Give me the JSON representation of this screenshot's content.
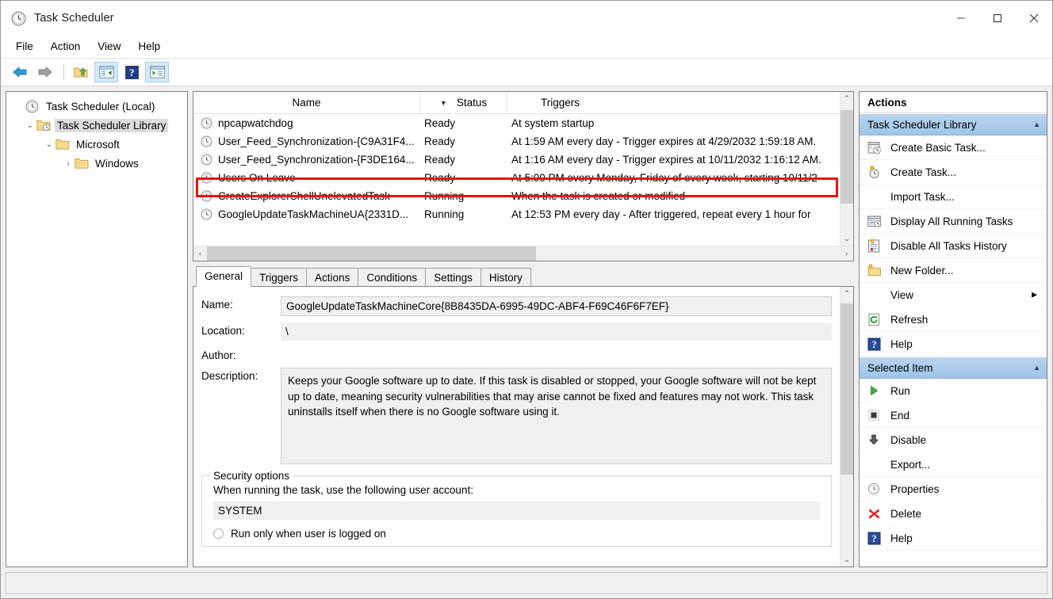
{
  "window": {
    "title": "Task Scheduler",
    "icon": "clock-icon",
    "minimize_label": "–",
    "maximize_label": "□",
    "close_label": "✕"
  },
  "menubar": {
    "items": [
      {
        "label": "File"
      },
      {
        "label": "Action"
      },
      {
        "label": "View"
      },
      {
        "label": "Help"
      }
    ]
  },
  "toolbar": {
    "buttons": [
      {
        "name": "back-arrow-icon",
        "label": ""
      },
      {
        "name": "forward-arrow-icon",
        "label": ""
      },
      {
        "name": "up-one-level-icon",
        "label": ""
      },
      {
        "name": "show-hide-console-tree-icon",
        "label": ""
      },
      {
        "name": "help-icon",
        "label": ""
      },
      {
        "name": "show-hide-action-pane-icon",
        "label": ""
      }
    ]
  },
  "tree": {
    "nodes": [
      {
        "label": "Task Scheduler (Local)",
        "icon": "clock-icon",
        "indent": 0,
        "chevron": "",
        "selected": false
      },
      {
        "label": "Task Scheduler Library",
        "icon": "library-folder-icon",
        "indent": 1,
        "chevron": "⌄",
        "selected": true
      },
      {
        "label": "Microsoft",
        "icon": "folder-icon",
        "indent": 2,
        "chevron": "⌄",
        "selected": false
      },
      {
        "label": "Windows",
        "icon": "folder-icon",
        "indent": 3,
        "chevron": "›",
        "selected": false
      }
    ]
  },
  "tasklist": {
    "columns": [
      {
        "label": "Name",
        "sorted": false
      },
      {
        "label": "Status",
        "sorted": true,
        "sort_arrow": "▼"
      },
      {
        "label": "Triggers",
        "sorted": false
      }
    ],
    "rows": [
      {
        "name": "npcapwatchdog",
        "status": "Ready",
        "trigger": "At system startup",
        "highlighted": false
      },
      {
        "name": "User_Feed_Synchronization-{C9A31F4...",
        "status": "Ready",
        "trigger": "At 1:59 AM every day - Trigger expires at 4/29/2032 1:59:18 AM.",
        "highlighted": false
      },
      {
        "name": "User_Feed_Synchronization-{F3DE164...",
        "status": "Ready",
        "trigger": "At 1:16 AM every day - Trigger expires at 10/11/2032 1:16:12 AM.",
        "highlighted": false
      },
      {
        "name": "Users On Leave",
        "status": "Ready",
        "trigger": "At 5:00 PM every Monday, Friday of every week, starting 10/11/2",
        "highlighted": true
      },
      {
        "name": "CreateExplorerShellUnelevatedTask",
        "status": "Running",
        "trigger": "When the task is created or modified",
        "highlighted": false
      },
      {
        "name": "GoogleUpdateTaskMachineUA{2331D...",
        "status": "Running",
        "trigger": "At 12:53 PM every day - After triggered, repeat every 1 hour for",
        "highlighted": false
      }
    ],
    "scroll_up_glyph": "⌃",
    "scroll_down_glyph": "⌄",
    "scroll_left_glyph": "‹",
    "scroll_right_glyph": "›"
  },
  "tabs": [
    {
      "label": "General",
      "active": true
    },
    {
      "label": "Triggers",
      "active": false
    },
    {
      "label": "Actions",
      "active": false
    },
    {
      "label": "Conditions",
      "active": false
    },
    {
      "label": "Settings",
      "active": false
    },
    {
      "label": "History",
      "active": false
    }
  ],
  "general": {
    "name_label": "Name:",
    "name_value": "GoogleUpdateTaskMachineCore{8B8435DA-6995-49DC-ABF4-F69C46F6F7EF}",
    "location_label": "Location:",
    "location_value": "\\",
    "author_label": "Author:",
    "author_value": "",
    "description_label": "Description:",
    "description_value": "Keeps your Google software up to date. If this task is disabled or stopped, your Google software will not be kept up to date, meaning security vulnerabilities that may arise cannot be fixed and features may not work. This task uninstalls itself when there is no Google software using it.",
    "security_group_title": "Security options",
    "security_prompt": "When running the task, use the following user account:",
    "account": "SYSTEM",
    "run_only_logged_on_label": "Run only when user is logged on"
  },
  "actions": {
    "title": "Actions",
    "sections": [
      {
        "title": "Task Scheduler Library",
        "collapse_glyph": "▲",
        "items": [
          {
            "label": "Create Basic Task...",
            "icon": "create-basic-task-icon"
          },
          {
            "label": "Create Task...",
            "icon": "create-task-icon"
          },
          {
            "label": "Import Task...",
            "icon": ""
          },
          {
            "label": "Display All Running Tasks",
            "icon": "display-running-tasks-icon"
          },
          {
            "label": "Disable All Tasks History",
            "icon": "disable-history-icon"
          },
          {
            "label": "New Folder...",
            "icon": "new-folder-icon"
          },
          {
            "label": "View",
            "icon": "",
            "submenu": true,
            "submenu_glyph": "▶"
          },
          {
            "label": "Refresh",
            "icon": "refresh-icon"
          },
          {
            "label": "Help",
            "icon": "help-icon"
          }
        ]
      },
      {
        "title": "Selected Item",
        "collapse_glyph": "▲",
        "items": [
          {
            "label": "Run",
            "icon": "run-play-icon"
          },
          {
            "label": "End",
            "icon": "end-stop-icon"
          },
          {
            "label": "Disable",
            "icon": "disable-down-arrow-icon"
          },
          {
            "label": "Export...",
            "icon": ""
          },
          {
            "label": "Properties",
            "icon": "clock-icon"
          },
          {
            "label": "Delete",
            "icon": "delete-x-icon"
          },
          {
            "label": "Help",
            "icon": "help-icon"
          }
        ]
      }
    ]
  },
  "annotation": {
    "highlight_color": "#ee1111",
    "highlighted_row": "Users On Leave"
  }
}
